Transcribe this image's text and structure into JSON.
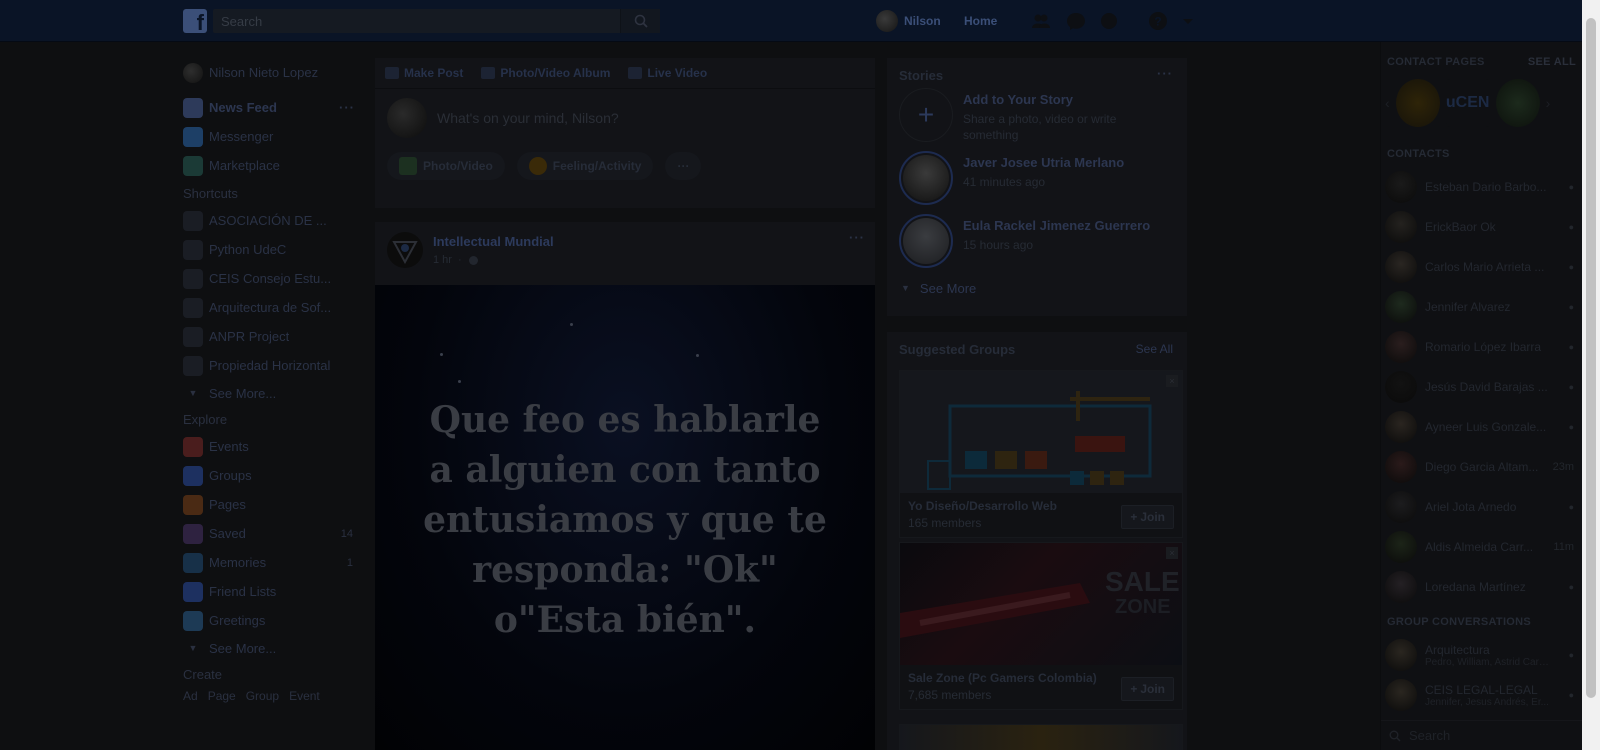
{
  "header": {
    "search_placeholder": "Search",
    "profile_name": "Nilson",
    "home_label": "Home"
  },
  "left_nav": {
    "profile_name": "Nilson Nieto Lopez",
    "main_items": [
      {
        "label": "News Feed",
        "icon": "news-feed-icon",
        "color": "#2d3a5a"
      },
      {
        "label": "Messenger",
        "icon": "messenger-icon",
        "color": "#1d3f66"
      },
      {
        "label": "Marketplace",
        "icon": "marketplace-icon",
        "color": "#1b3a36"
      }
    ],
    "shortcuts_heading": "Shortcuts",
    "shortcuts": [
      {
        "label": "ASOCIACIÓN DE ..."
      },
      {
        "label": "Python UdeC"
      },
      {
        "label": "CEIS Consejo Estu..."
      },
      {
        "label": "Arquitectura de Sof..."
      },
      {
        "label": "ANPR Project"
      },
      {
        "label": "Propiedad Horizontal"
      }
    ],
    "shortcuts_see_more": "See More...",
    "explore_heading": "Explore",
    "explore": [
      {
        "label": "Events",
        "icon": "calendar-icon",
        "color": "#4a1d1d",
        "count": ""
      },
      {
        "label": "Groups",
        "icon": "groups-icon",
        "color": "#1d3060",
        "count": ""
      },
      {
        "label": "Pages",
        "icon": "pages-flag-icon",
        "color": "#4a2a14",
        "count": ""
      },
      {
        "label": "Saved",
        "icon": "saved-bookmark-icon",
        "color": "#2e2240",
        "count": "14"
      },
      {
        "label": "Memories",
        "icon": "memories-clock-icon",
        "color": "#173048",
        "count": "1"
      },
      {
        "label": "Friend Lists",
        "icon": "friend-lists-icon",
        "color": "#1d3060",
        "count": ""
      },
      {
        "label": "Greetings",
        "icon": "greetings-icon",
        "color": "#1d3a55",
        "count": ""
      }
    ],
    "explore_see_more": "See More...",
    "create_heading": "Create",
    "create_links": [
      "Ad",
      "Page",
      "Group",
      "Event"
    ]
  },
  "composer": {
    "tabs": [
      "Make Post",
      "Photo/Video Album",
      "Live Video"
    ],
    "placeholder": "What's on your mind, Nilson?",
    "actions": [
      "Photo/Video",
      "Feeling/Activity"
    ],
    "more": "···"
  },
  "post": {
    "page_name": "Intellectual Mundial",
    "time": "1 hr",
    "quote": "Que feo es hablarle a alguien con tanto entusiamos y que te responda: \"Ok\" o\"Esta bién\"."
  },
  "stories": {
    "title": "Stories",
    "add_title": "Add to Your Story",
    "add_sub": "Share a photo, video or write something",
    "items": [
      {
        "name": "Javer Josee Utria Merlano",
        "time": "41 minutes ago"
      },
      {
        "name": "Eula Rackel Jimenez Guerrero",
        "time": "15 hours ago"
      }
    ],
    "see_more": "See More"
  },
  "suggested_groups": {
    "title": "Suggested Groups",
    "see_all": "See All",
    "groups": [
      {
        "name": "Yo Diseño/Desarrollo Web",
        "members": "165 members",
        "join": "Join"
      },
      {
        "name": "Sale Zone (Pc Gamers Colombia)",
        "members": "7,685 members",
        "join": "Join"
      }
    ]
  },
  "chat": {
    "contact_pages_heading": "CONTACT PAGES",
    "see_all": "SEE ALL",
    "contacts_heading": "CONTACTS",
    "contacts": [
      {
        "name": "Esteban Dario Barbo...",
        "time": ""
      },
      {
        "name": "ErickBaor Ok",
        "time": ""
      },
      {
        "name": "Carlos Mario Arrieta ...",
        "time": ""
      },
      {
        "name": "Jennifer Alvarez",
        "time": ""
      },
      {
        "name": "Romario López Ibarra",
        "time": ""
      },
      {
        "name": "Jesús David Barajas ...",
        "time": ""
      },
      {
        "name": "Ayneer Luis Gonzale...",
        "time": ""
      },
      {
        "name": "Diego Garcia Altam...",
        "time": "23m"
      },
      {
        "name": "Ariel Jota Arnedo",
        "time": ""
      },
      {
        "name": "Aldis Almeida Carr...",
        "time": "11m"
      },
      {
        "name": "Loredana Martínez",
        "time": ""
      }
    ],
    "group_conv_heading": "GROUP CONVERSATIONS",
    "group_convs": [
      {
        "name": "Arquitectura",
        "members": "Pedro, William, Astrid Caro..."
      },
      {
        "name": "CEIS LEGAL-LEGAL",
        "members": "Jennifer, Jesus Andrés, Er..."
      }
    ],
    "search_placeholder": "Search"
  }
}
